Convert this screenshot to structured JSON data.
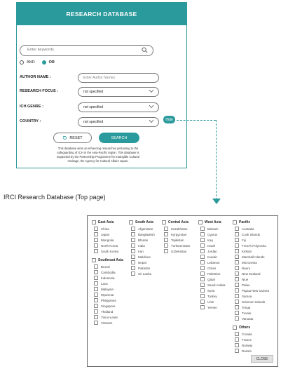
{
  "header": {
    "title": "RESEARCH DATABASE"
  },
  "search": {
    "placeholder": "Enter keywords"
  },
  "logic": {
    "and_label": "AND",
    "or_label": "OR"
  },
  "fields": {
    "author": {
      "label": "AUTHOR NAME :",
      "placeholder": "Enter Author Names"
    },
    "focus": {
      "label": "RESEARCH FOCUS :",
      "value": "not specified"
    },
    "genre": {
      "label": "ICH GENRE :",
      "value": "not specified"
    },
    "country": {
      "label": "COUNTRY :",
      "value": "not specified"
    }
  },
  "buttons": {
    "hide": "Hide",
    "reset": "RESET",
    "search": "SEARCH",
    "close": "CLOSE"
  },
  "description": "This database aims at enhancing researches pertaining to the safeguarding of ICH in the Asia-Pacific region. This database is supported by the Partnership Programme for Intangible Cultural Heritage, the Agency for Cultural Affairs Japan.",
  "caption": "IRCI Research Database (Top page)",
  "regions": {
    "east_asia": {
      "name": "East Asia",
      "items": [
        "China",
        "Japan",
        "Mongolia",
        "North Korea",
        "South Korea"
      ]
    },
    "southeast_asia": {
      "name": "Southeast Asia",
      "items": [
        "Brunei",
        "Cambodia",
        "Indonesia",
        "Laos",
        "Malaysia",
        "Myanmar",
        "Philippines",
        "Singapore",
        "Thailand",
        "Timor-Leste",
        "Vietnam"
      ]
    },
    "south_asia": {
      "name": "South Asia",
      "items": [
        "Afganistan",
        "Bangladesh",
        "Bhutan",
        "India",
        "Iran",
        "Maldives",
        "Nepal",
        "Pakistan",
        "Sri Lanka"
      ]
    },
    "central_asia": {
      "name": "Central Asia",
      "items": [
        "Kazakhstan",
        "Kyrgyzstan",
        "Tajikistan",
        "Turkmenistan",
        "Uzbekistan"
      ]
    },
    "west_asia": {
      "name": "West Asia",
      "items": [
        "Bahrain",
        "Cyprus",
        "Iraq",
        "Israel",
        "Jordan",
        "Kuwait",
        "Lebanon",
        "Oman",
        "Palestine",
        "Qatar",
        "Saudi Arabia",
        "Syria",
        "Turkey",
        "UAE",
        "Yemen"
      ]
    },
    "pacific": {
      "name": "Pacific",
      "items": [
        "Australia",
        "Cook Islands",
        "Fiji",
        "French Polynesia",
        "Kiribati",
        "Marshall Islands",
        "Micronesia",
        "Nauru",
        "New Zealand",
        "Niue",
        "Palau",
        "Papua New Guinea",
        "Samoa",
        "Solomon Islands",
        "Tonga",
        "Tuvalu",
        "Vanuatu"
      ]
    },
    "others": {
      "name": "Others",
      "items": [
        "Croatia",
        "France",
        "Norway",
        "Russia"
      ]
    }
  },
  "colors": {
    "accent": "#2b9a9c"
  }
}
